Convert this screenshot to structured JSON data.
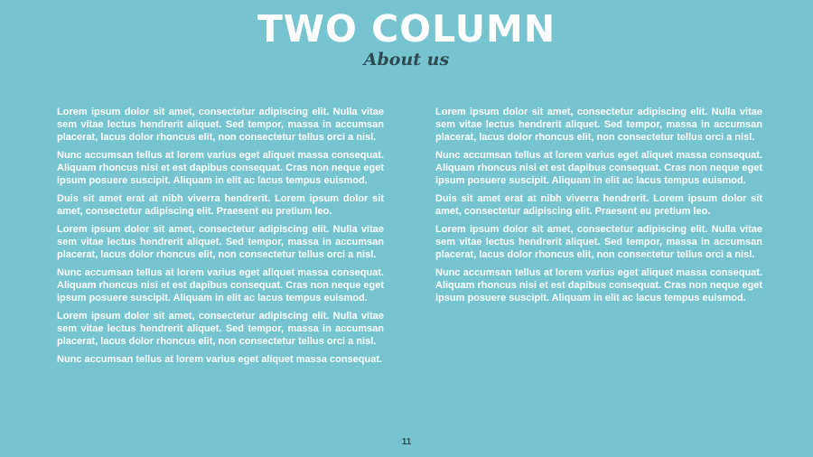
{
  "slide": {
    "title": "TWO COLUMN",
    "subtitle": "About us",
    "page_number": "11"
  },
  "columns": {
    "left": [
      "Lorem ipsum dolor sit amet, consectetur adipiscing elit. Nulla vitae sem vitae lectus hendrerit aliquet. Sed tempor, massa in accumsan placerat, lacus dolor rhoncus elit, non consectetur tellus orci a nisl.",
      "Nunc accumsan tellus at lorem varius eget aliquet massa consequat. Aliquam rhoncus nisi et est dapibus consequat. Cras non neque eget ipsum posuere suscipit. Aliquam in elit ac lacus tempus euismod.",
      "Duis sit amet erat at nibh viverra hendrerit. Lorem ipsum dolor sit amet, consectetur adipiscing elit. Praesent eu pretium leo.",
      "Lorem ipsum dolor sit amet, consectetur adipiscing elit. Nulla vitae sem vitae lectus hendrerit aliquet. Sed tempor, massa in accumsan placerat, lacus dolor rhoncus elit, non consectetur tellus orci a nisl.",
      "Nunc accumsan tellus at lorem varius eget aliquet massa consequat. Aliquam rhoncus nisi et est dapibus consequat. Cras non neque eget ipsum posuere suscipit. Aliquam in elit ac lacus tempus euismod.",
      "Lorem ipsum dolor sit amet, consectetur adipiscing elit. Nulla vitae sem vitae lectus hendrerit aliquet. Sed tempor, massa in accumsan placerat, lacus dolor rhoncus elit, non consectetur tellus orci a nisl.",
      "Nunc accumsan tellus at lorem varius eget aliquet massa consequat."
    ],
    "right": [
      "Lorem ipsum dolor sit amet, consectetur adipiscing elit. Nulla vitae sem vitae lectus hendrerit aliquet. Sed tempor, massa in accumsan placerat, lacus dolor rhoncus elit, non consectetur tellus orci a nisl.",
      "Nunc accumsan tellus at lorem varius eget aliquet massa consequat. Aliquam rhoncus nisi et est dapibus consequat. Cras non neque eget ipsum posuere suscipit. Aliquam in elit ac lacus tempus euismod.",
      "Duis sit amet erat at nibh viverra hendrerit. Lorem ipsum dolor sit amet, consectetur adipiscing elit. Praesent eu pretium leo.",
      "Lorem ipsum dolor sit amet, consectetur adipiscing elit. Nulla vitae sem vitae lectus hendrerit aliquet. Sed tempor, massa in accumsan placerat, lacus dolor rhoncus elit, non consectetur tellus orci a nisl.",
      "Nunc accumsan tellus at lorem varius eget aliquet massa consequat. Aliquam rhoncus nisi et est dapibus consequat. Cras non neque eget ipsum posuere suscipit. Aliquam in elit ac lacus tempus euismod."
    ]
  },
  "colors": {
    "background": "#75c4cf",
    "title": "#ffffff",
    "subtitle": "#2f4a50",
    "body_text": "#ffffff"
  }
}
